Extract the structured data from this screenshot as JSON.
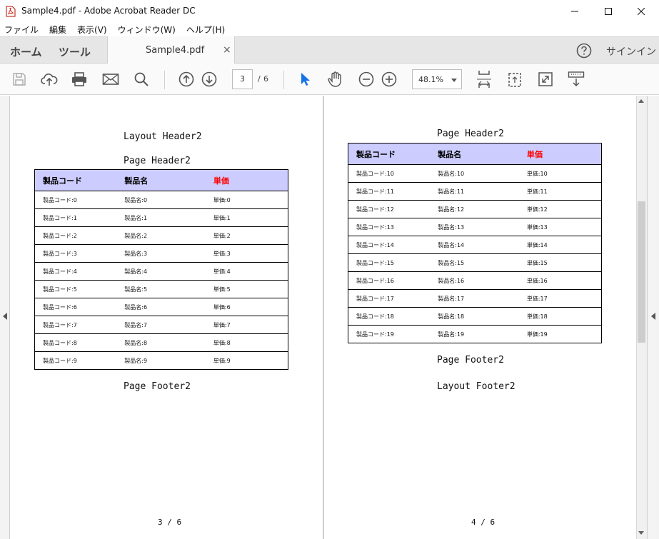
{
  "window": {
    "title": "Sample4.pdf - Adobe Acrobat Reader DC"
  },
  "menu": [
    "ファイル",
    "編集",
    "表示(V)",
    "ウィンドウ(W)",
    "ヘルプ(H)"
  ],
  "tabs": {
    "home": "ホーム",
    "tools": "ツール",
    "document": "Sample4.pdf",
    "close": "×",
    "signin": "サインイン"
  },
  "toolbar": {
    "current_page": "3",
    "page_separator": "/",
    "total_pages": "6",
    "zoom": "48.1%"
  },
  "colors": {
    "header_bg": "#ccccff",
    "price_header": "#ff0000",
    "accent": "#1473e6"
  },
  "pages": [
    {
      "layout_header": "Layout Header2",
      "page_header": "Page Header2",
      "columns": [
        "製品コード",
        "製品名",
        "単価"
      ],
      "rows": [
        [
          "製品コード:0",
          "製品名:0",
          "単価:0"
        ],
        [
          "製品コード:1",
          "製品名:1",
          "単価:1"
        ],
        [
          "製品コード:2",
          "製品名:2",
          "単価:2"
        ],
        [
          "製品コード:3",
          "製品名:3",
          "単価:3"
        ],
        [
          "製品コード:4",
          "製品名:4",
          "単価:4"
        ],
        [
          "製品コード:5",
          "製品名:5",
          "単価:5"
        ],
        [
          "製品コード:6",
          "製品名:6",
          "単価:6"
        ],
        [
          "製品コード:7",
          "製品名:7",
          "単価:7"
        ],
        [
          "製品コード:8",
          "製品名:8",
          "単価:8"
        ],
        [
          "製品コード:9",
          "製品名:9",
          "単価:9"
        ]
      ],
      "page_footer": "Page Footer2",
      "page_number": "3 / 6"
    },
    {
      "page_header": "Page Header2",
      "columns": [
        "製品コード",
        "製品名",
        "単価"
      ],
      "rows": [
        [
          "製品コード:10",
          "製品名:10",
          "単価:10"
        ],
        [
          "製品コード:11",
          "製品名:11",
          "単価:11"
        ],
        [
          "製品コード:12",
          "製品名:12",
          "単価:12"
        ],
        [
          "製品コード:13",
          "製品名:13",
          "単価:13"
        ],
        [
          "製品コード:14",
          "製品名:14",
          "単価:14"
        ],
        [
          "製品コード:15",
          "製品名:15",
          "単価:15"
        ],
        [
          "製品コード:16",
          "製品名:16",
          "単価:16"
        ],
        [
          "製品コード:17",
          "製品名:17",
          "単価:17"
        ],
        [
          "製品コード:18",
          "製品名:18",
          "単価:18"
        ],
        [
          "製品コード:19",
          "製品名:19",
          "単価:19"
        ]
      ],
      "page_footer": "Page Footer2",
      "layout_footer": "Layout Footer2",
      "page_number": "4 / 6"
    }
  ]
}
